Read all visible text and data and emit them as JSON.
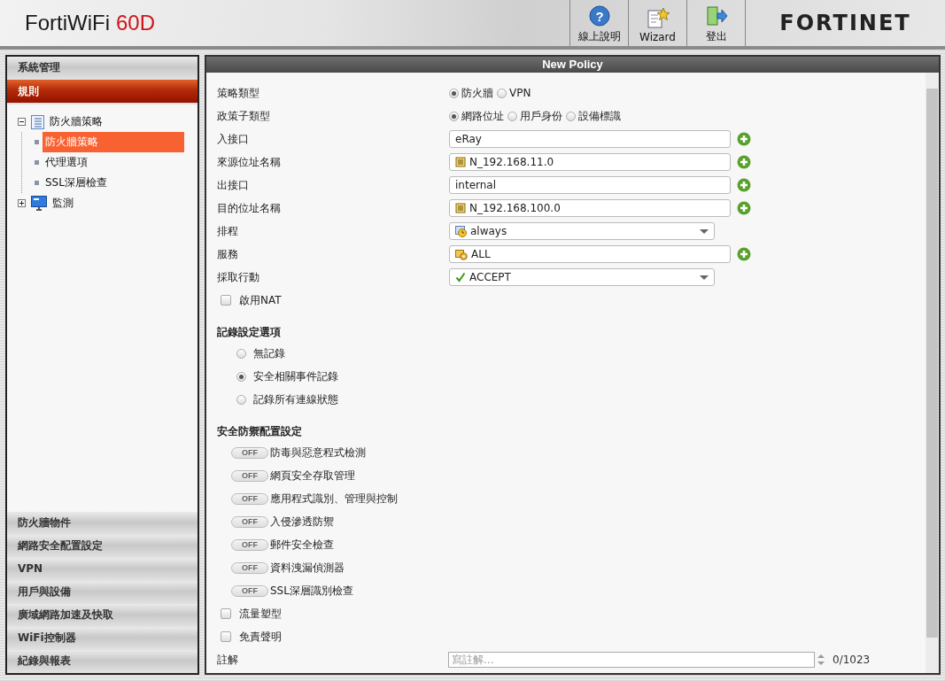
{
  "header": {
    "product_name": "FortiWiFi",
    "model": "60D",
    "toolbar_buttons": [
      {
        "label": "線上說明",
        "kind": "help",
        "icon_glyph": "?"
      },
      {
        "label": "Wizard",
        "kind": "wizard"
      },
      {
        "label": "登出",
        "kind": "logout"
      }
    ],
    "logo": "FORTINET"
  },
  "sidebar": {
    "top_sections": [
      {
        "label": "系統管理",
        "selected": false
      },
      {
        "label": "規則",
        "selected": true
      }
    ],
    "tree": [
      {
        "label": "防火牆策略",
        "kind": "list",
        "expanded": true,
        "children": [
          {
            "label": "防火牆策略",
            "selected": true
          },
          {
            "label": "代理選項",
            "selected": false
          },
          {
            "label": "SSL深層檢查",
            "selected": false
          }
        ]
      },
      {
        "label": "監測",
        "kind": "monitor",
        "expanded": false
      }
    ],
    "bottom_sections": [
      {
        "label": "防火牆物件",
        "selected": false
      },
      {
        "label": "網路安全配置設定",
        "selected": false
      },
      {
        "label": "VPN",
        "selected": false
      },
      {
        "label": "用戶與設備",
        "selected": false
      },
      {
        "label": "廣域網路加速及快取",
        "selected": false
      },
      {
        "label": "WiFi控制器",
        "selected": false
      },
      {
        "label": "紀錄與報表",
        "selected": false
      }
    ]
  },
  "panel": {
    "title": "New Policy",
    "fields": [
      {
        "label": "策略類型",
        "kind": "radio",
        "options": [
          {
            "label": "防火牆",
            "selected": true
          },
          {
            "label": "VPN",
            "selected": false
          }
        ]
      },
      {
        "label": "政策子類型",
        "kind": "radio",
        "options": [
          {
            "label": "網路位址",
            "selected": true
          },
          {
            "label": "用戶身份",
            "selected": false
          },
          {
            "label": "設備標識",
            "selected": false
          }
        ]
      },
      {
        "label": "入接口",
        "kind": "interface",
        "value": "eRay"
      },
      {
        "label": "來源位址名稱",
        "kind": "address",
        "value": "N_192.168.11.0"
      },
      {
        "label": "出接口",
        "kind": "interface",
        "value": "internal"
      },
      {
        "label": "目的位址名稱",
        "kind": "address",
        "value": "N_192.168.100.0"
      },
      {
        "label": "排程",
        "kind": "schedule",
        "value": "always"
      },
      {
        "label": "服務",
        "kind": "service",
        "value": "ALL"
      },
      {
        "label": "採取行動",
        "kind": "action",
        "value": "ACCEPT"
      }
    ],
    "nat": {
      "label": "啟用NAT",
      "checked": false
    },
    "logging": {
      "heading": "記錄設定選項",
      "options": [
        {
          "label": "無記錄",
          "selected": false
        },
        {
          "label": "安全相關事件記錄",
          "selected": true
        },
        {
          "label": "記錄所有連線狀態",
          "selected": false
        }
      ]
    },
    "security": {
      "heading": "安全防禦配置設定",
      "profiles": [
        {
          "label": "防毒與惡意程式檢測",
          "on": false,
          "switch_text": "OFF"
        },
        {
          "label": "網頁安全存取管理",
          "on": false,
          "switch_text": "OFF"
        },
        {
          "label": "應用程式識別、管理與控制",
          "on": false,
          "switch_text": "OFF"
        },
        {
          "label": "入侵滲透防禦",
          "on": false,
          "switch_text": "OFF"
        },
        {
          "label": "郵件安全檢查",
          "on": false,
          "switch_text": "OFF"
        },
        {
          "label": "資料洩漏偵測器",
          "on": false,
          "switch_text": "OFF"
        },
        {
          "label": "SSL深層識別檢查",
          "on": false,
          "switch_text": "OFF"
        }
      ]
    },
    "options": [
      {
        "label": "流量塑型",
        "checked": false
      },
      {
        "label": "免責聲明",
        "checked": false
      }
    ],
    "comment": {
      "label": "註解",
      "placeholder": "寫註解...",
      "counter": "0/1023"
    }
  }
}
